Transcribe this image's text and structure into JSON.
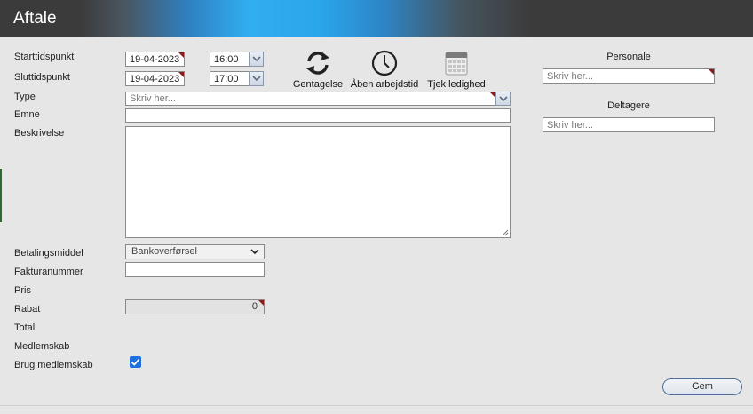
{
  "window": {
    "title": "Aftale"
  },
  "form": {
    "start_label": "Starttidspunkt",
    "start_date": "19-04-2023",
    "start_time": "16:00",
    "end_label": "Sluttidspunkt",
    "end_date": "19-04-2023",
    "end_time": "17:00",
    "type_label": "Type",
    "type_placeholder": "Skriv her...",
    "subject_label": "Emne",
    "subject_value": "",
    "description_label": "Beskrivelse",
    "payment_label": "Betalingsmiddel",
    "payment_value": "Bankoverførsel",
    "invoice_label": "Fakturanummer",
    "invoice_value": "",
    "price_label": "Pris",
    "discount_label": "Rabat",
    "discount_value": "0",
    "total_label": "Total",
    "membership_label": "Medlemskab",
    "use_membership_label": "Brug medlemskab",
    "use_membership_checked": true
  },
  "actions": {
    "repeat_label": "Gentagelse",
    "open_hours_label": "Åben arbejdstid",
    "check_availability_label": "Tjek ledighed"
  },
  "right_panel": {
    "staff_title": "Personale",
    "staff_placeholder": "Skriv her...",
    "participants_title": "Deltagere",
    "participants_placeholder": "Skriv her..."
  },
  "footer": {
    "save_label": "Gem"
  },
  "colors": {
    "accent_blue": "#30aef0",
    "required_marker": "#8b1a1a",
    "checkbox": "#1f6fdc"
  }
}
